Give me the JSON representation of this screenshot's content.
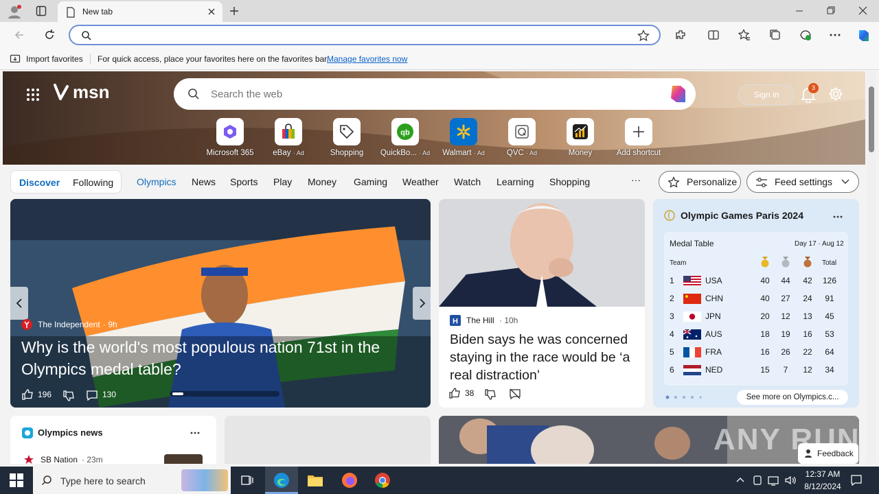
{
  "browser": {
    "tab_title": "New tab",
    "address_value": "",
    "favorites_bar": {
      "import_label": "Import favorites",
      "hint": "For quick access, place your favorites here on the favorites bar.",
      "manage_link": "Manage favorites now"
    }
  },
  "msn": {
    "logo_text": "msn",
    "search_placeholder": "Search the web",
    "sign_in": "Sign in",
    "notification_count": "3",
    "shortcuts": [
      {
        "label": "Microsoft 365",
        "ad": ""
      },
      {
        "label": "eBay",
        "ad": "· Ad"
      },
      {
        "label": "Shopping",
        "ad": ""
      },
      {
        "label": "QuickBo...",
        "ad": "· Ad"
      },
      {
        "label": "Walmart",
        "ad": "· Ad"
      },
      {
        "label": "QVC",
        "ad": "· Ad"
      },
      {
        "label": "Money",
        "ad": ""
      },
      {
        "label": "Add shortcut",
        "ad": ""
      }
    ],
    "nav": {
      "discover": "Discover",
      "following": "Following",
      "items": [
        "Olympics",
        "News",
        "Sports",
        "Play",
        "Money",
        "Gaming",
        "Weather",
        "Watch",
        "Learning",
        "Shopping"
      ],
      "more": "···",
      "personalize": "Personalize",
      "feed_settings": "Feed settings"
    },
    "main_story": {
      "source": "The Independent",
      "age": "· 9h",
      "title": "Why is the world's most populous nation 71st in the Olympics medal table?",
      "likes": "196",
      "comments": "130"
    },
    "second_story": {
      "source": "The Hill",
      "age": "· 10h",
      "title": "Biden says he was concerned staying in the race would be ‘a real distraction’",
      "likes": "38"
    },
    "olympics_card": {
      "title": "Olympic Games Paris 2024",
      "medal_table_label": "Medal Table",
      "day_range": "Day 17 · Aug 12",
      "team_header": "Team",
      "total_header": "Total",
      "rows": [
        {
          "rank": "1",
          "team": "USA",
          "gold": "40",
          "silver": "44",
          "bronze": "42",
          "total": "126"
        },
        {
          "rank": "2",
          "team": "CHN",
          "gold": "40",
          "silver": "27",
          "bronze": "24",
          "total": "91"
        },
        {
          "rank": "3",
          "team": "JPN",
          "gold": "20",
          "silver": "12",
          "bronze": "13",
          "total": "45"
        },
        {
          "rank": "4",
          "team": "AUS",
          "gold": "18",
          "silver": "19",
          "bronze": "16",
          "total": "53"
        },
        {
          "rank": "5",
          "team": "FRA",
          "gold": "16",
          "silver": "26",
          "bronze": "22",
          "total": "64"
        },
        {
          "rank": "6",
          "team": "NED",
          "gold": "15",
          "silver": "7",
          "bronze": "12",
          "total": "34"
        }
      ],
      "see_more": "See more on Olympics.c..."
    },
    "olympics_news": {
      "title": "Olympics news",
      "item_source": "SB Nation",
      "item_age": "· 23m"
    },
    "feedback": "Feedback"
  },
  "taskbar": {
    "search_placeholder": "Type here to search",
    "time": "12:37 AM",
    "date": "8/12/2024"
  },
  "watermark": "ANY RUN"
}
